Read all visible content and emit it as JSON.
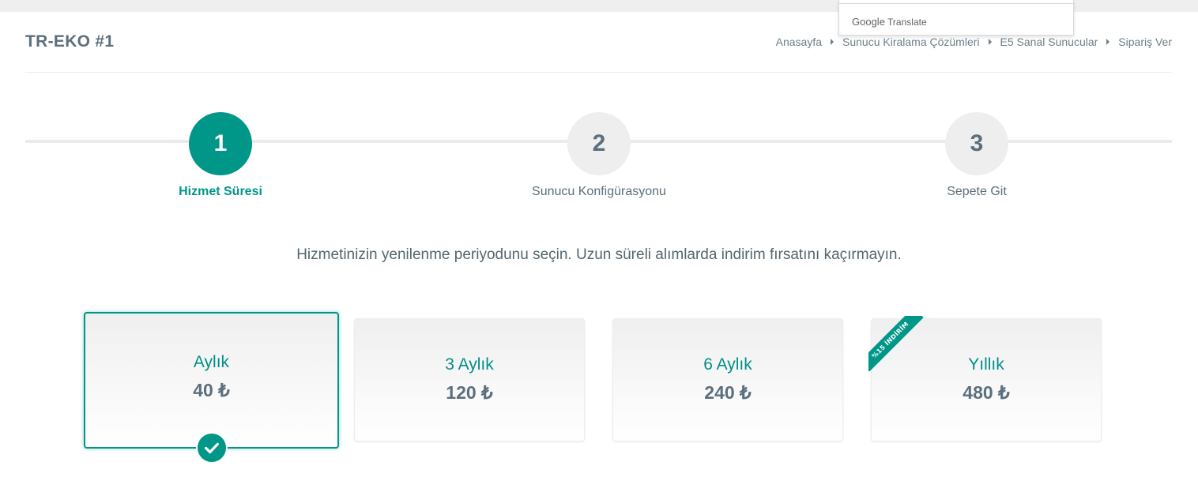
{
  "google_translate": {
    "brand": "Google",
    "label": "Translate"
  },
  "header": {
    "title": "TR-EKO #1"
  },
  "breadcrumb": [
    "Anasayfa",
    "Sunucu Kiralama Çözümleri",
    "E5 Sanal Sunucular",
    "Sipariş Ver"
  ],
  "steps": [
    {
      "number": "1",
      "label": "Hizmet Süresi",
      "active": true
    },
    {
      "number": "2",
      "label": "Sunucu Konfigürasyonu",
      "active": false
    },
    {
      "number": "3",
      "label": "Sepete Git",
      "active": false
    }
  ],
  "intro": "Hizmetinizin yenilenme periyodunu seçin. Uzun süreli alımlarda indirim fırsatını kaçırmayın.",
  "plans": [
    {
      "period": "Aylık",
      "price": "40 ₺",
      "selected": true
    },
    {
      "period": "3 Aylık",
      "price": "120 ₺",
      "selected": false
    },
    {
      "period": "6 Aylık",
      "price": "240 ₺",
      "selected": false
    },
    {
      "period": "Yıllık",
      "price": "480 ₺",
      "selected": false,
      "ribbon": "%15 İNDİRİM"
    }
  ],
  "colors": {
    "accent": "#009688",
    "text": "#5c6f7c",
    "step_inactive": "#eeeeee"
  },
  "icons": {
    "selected": "check-icon",
    "breadcrumb_separator": "caret-right-icon"
  }
}
